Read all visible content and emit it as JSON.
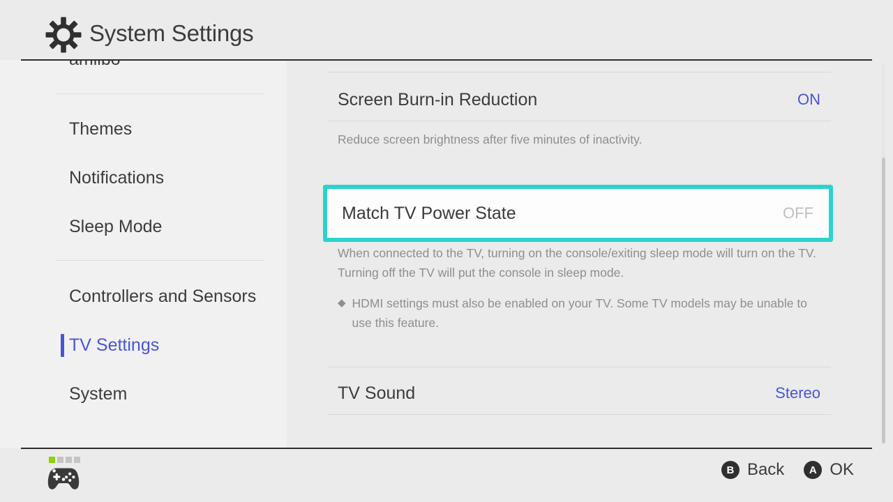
{
  "header": {
    "title": "System Settings",
    "icon": "gear-icon"
  },
  "sidebar": {
    "items": [
      {
        "label": "amiibo",
        "selected": false,
        "clipped": true
      },
      {
        "label": "Themes",
        "selected": false
      },
      {
        "label": "Notifications",
        "selected": false
      },
      {
        "label": "Sleep Mode",
        "selected": false
      },
      {
        "label": "Controllers and Sensors",
        "selected": false
      },
      {
        "label": "TV Settings",
        "selected": true
      },
      {
        "label": "System",
        "selected": false
      }
    ]
  },
  "main": {
    "rows": [
      {
        "title": "Screen Burn-in Reduction",
        "value": "ON",
        "description": "Reduce screen brightness after five minutes of inactivity.",
        "highlighted": false
      },
      {
        "title": "Match TV Power State",
        "value": "OFF",
        "description": "When connected to the TV, turning on the console/exiting sleep mode will turn on the TV. Turning off the TV will put the console in sleep mode.",
        "note_bullet": "◆",
        "note": "HDMI settings must also be enabled on your TV. Some TV models may be unable to use this feature.",
        "highlighted": true
      },
      {
        "title": "TV Sound",
        "value": "Stereo",
        "highlighted": false
      }
    ]
  },
  "footer": {
    "controller": {
      "icon": "gamepad-icon",
      "player_leds": [
        true,
        false,
        false,
        false
      ]
    },
    "actions": [
      {
        "glyph": "B",
        "label": "Back"
      },
      {
        "glyph": "A",
        "label": "OK"
      }
    ]
  },
  "colors": {
    "accent_blue": "#4a55d6",
    "highlight_cyan": "#2ad3cb",
    "led_green": "#8ed105",
    "page_bg": "#ebebeb",
    "sidebar_bg": "#f1f1f1",
    "text_primary": "#3c3c3c",
    "text_muted": "#8e8e8e",
    "value_off": "#bfbfbf"
  },
  "scrollbar": {
    "orientation": "vertical",
    "thumb_position_percent": 25
  }
}
